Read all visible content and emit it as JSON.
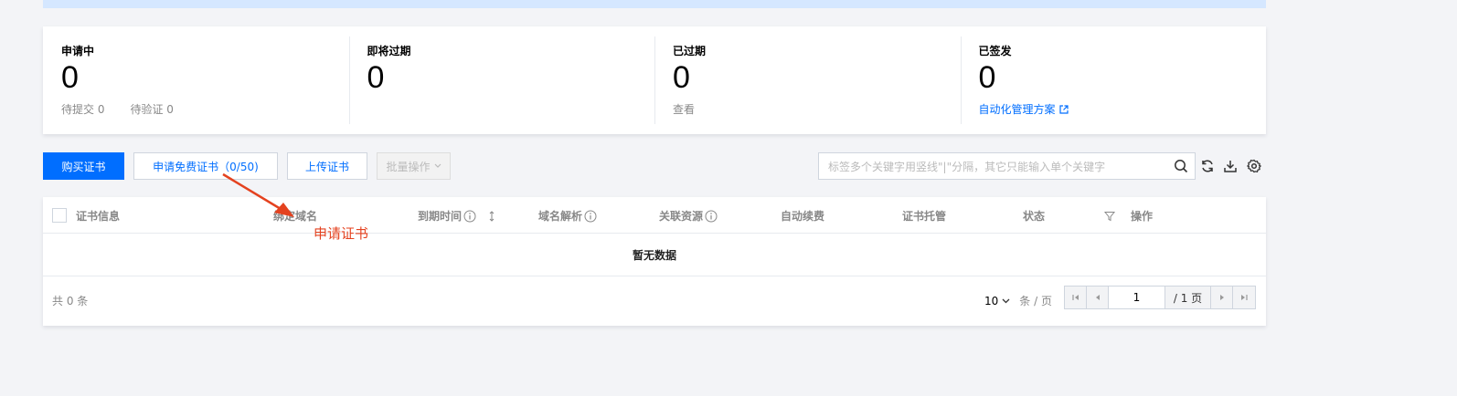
{
  "stats": [
    {
      "title": "申请中",
      "value": "0",
      "sub": [
        "待提交 0",
        "待验证 0"
      ]
    },
    {
      "title": "即将过期",
      "value": "0",
      "sub": []
    },
    {
      "title": "已过期",
      "value": "0",
      "sub": [
        "查看"
      ]
    },
    {
      "title": "已签发",
      "value": "0",
      "link": "自动化管理方案"
    }
  ],
  "toolbar": {
    "buy_label": "购买证书",
    "apply_free_label": "申请免费证书（0/50)",
    "upload_label": "上传证书",
    "batch_label": "批量操作",
    "search_placeholder": "标签多个关键字用竖线\"|\"分隔，其它只能输入单个关键字"
  },
  "table": {
    "columns": [
      "证书信息",
      "绑定域名",
      "到期时间",
      "域名解析",
      "关联资源",
      "自动续费",
      "证书托管",
      "状态",
      "操作"
    ],
    "empty_text": "暂无数据"
  },
  "footer": {
    "total": "共 0 条",
    "page_size": "10",
    "page_size_unit": "条 / 页",
    "current_page": "1",
    "total_pages": "/ 1 页"
  },
  "annotation": {
    "label": "申请证书",
    "color": "#e4421f"
  },
  "colors": {
    "primary": "#006eff",
    "background": "#f3f4f7"
  }
}
